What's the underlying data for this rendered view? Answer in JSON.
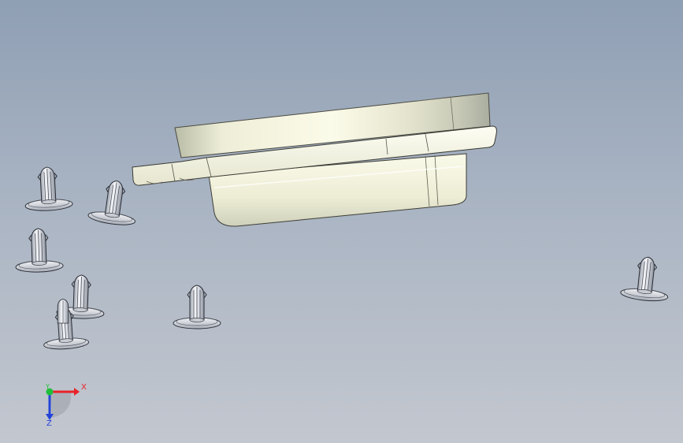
{
  "viewport": {
    "background_top": "#8f9fb4",
    "background_bottom": "#c3c7cf"
  },
  "model": {
    "connector_body_color": "#f3f2dc",
    "fastener_color": "#e6e8ee",
    "fastener_count": 8
  },
  "triad": {
    "x_label": "X",
    "y_label": "Y",
    "z_label": "Z",
    "x_color": "#e8222a",
    "y_color": "#1fbf3a",
    "z_color": "#2343d8"
  }
}
